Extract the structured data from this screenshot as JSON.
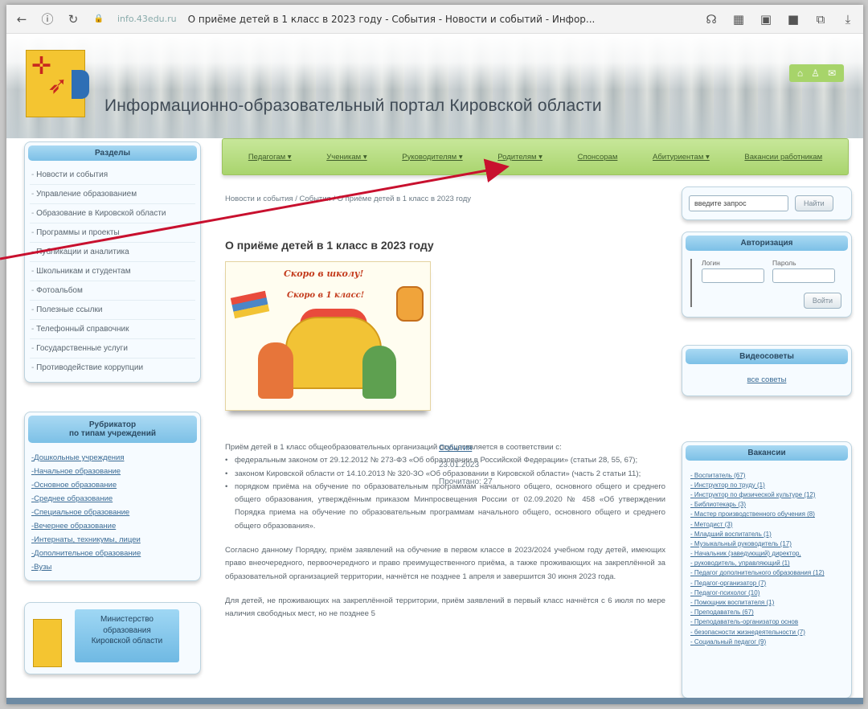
{
  "browser": {
    "back_icon": "←",
    "info_icon": "ⓘ",
    "reload_icon": "↻",
    "lock_icon": "🔒",
    "url": "info.43edu.ru",
    "tab_title": "О приёме детей в 1 класс в 2023 году - События - Новости и событий - Инфор..."
  },
  "header": {
    "site_title": "Информационно-образовательный портал Кировской области",
    "top_icons": [
      "⌂",
      "♙",
      "✉"
    ]
  },
  "sections": {
    "heading": "Разделы",
    "items": [
      "Новости и события",
      "Управление образованием",
      "Образование в Кировской области",
      "Программы и проекты",
      "Публикации и аналитика",
      "Школьникам и студентам",
      "Фотоальбом",
      "Полезные ссылки",
      "Телефонный справочник",
      "Государственные услуги",
      "Противодействие коррупции"
    ]
  },
  "rubricator": {
    "heading_line1": "Рубрикатор",
    "heading_line2": "по типам учреждений",
    "items": [
      "Дошкольные учреждения",
      "Начальное образование",
      "Основное образование",
      "Среднее образование",
      "Специальное образование",
      "Вечернее образование",
      "Интернаты, техникумы, лицеи",
      "Дополнительное образование",
      "Вузы"
    ]
  },
  "ministry": {
    "line1": "Министерство",
    "line2": "образования",
    "line3": "Кировской области"
  },
  "topnav": {
    "items": [
      "Педагогам ▾",
      "Ученикам ▾",
      "Руководителям ▾",
      "Родителям ▾",
      "Спонсорам",
      "Абитуриентам ▾",
      "Вакансии работникам"
    ]
  },
  "center": {
    "breadcrumb": "Новости и события / События / О приёме детей в 1 класс в 2023 году",
    "title": "О приёме детей в 1 класс в 2023 году",
    "hero_line1": "Скоро в школу!",
    "hero_line2": "Скоро в 1 класс!",
    "category": "События",
    "date": "23.01.2023",
    "views": "Прочитано: 27",
    "intro": "Приём детей в 1 класс общеобразовательных организаций осуществляется в соответствии с:",
    "bullets": [
      "федеральным законом от 29.12.2012 № 273-ФЗ «Об образовании в Российской Федерации» (статьи 28, 55, 67);",
      "законом Кировской области от 14.10.2013 № 320-ЗО «Об образовании в Кировской области» (часть 2 статьи 11);",
      "порядком приёма на обучение по образовательным программам начального общего, основного общего и среднего общего образования, утверждённым приказом Минпросвещения России от 02.09.2020 № 458 «Об утверждении Порядка приема на обучение по образовательным программам начального общего, основного общего и среднего общего образования»."
    ],
    "para2": "Согласно данному Порядку, приём заявлений на обучение в первом классе в 2023/2024 учебном году детей, имеющих право внеочередного, первоочередного и право преимущественного приёма, а также проживающих на закреплённой за образовательной организацией территории, начнётся не позднее 1 апреля и завершится 30 июня 2023 года.",
    "para3": "Для детей, не проживающих на закреплённой территории, приём заявлений в первый класс начнётся с 6 июля по мере наличия свободных мест, но не позднее 5"
  },
  "right": {
    "search_placeholder": "введите запрос",
    "search_button": "Найти",
    "auth_heading": "Авторизация",
    "login_label": "Логин",
    "password_label": "Пароль",
    "login_button": "Войти",
    "video_heading": "Видеосоветы",
    "video_link": "все советы",
    "vacancies_heading": "Вакансии",
    "vacancies": [
      "Воспитатель (67)",
      "Инструктор по труду (1)",
      "Инструктор по физической культуре (12)",
      "Библиотекарь (3)",
      "Мастер производственного обучения (8)",
      "Методист (3)",
      "Младший воспитатель (1)",
      "Музыкальный руководитель (17)",
      "Начальник (заведующий) директор,",
      "  руководитель, управляющий (1)",
      "Педагог дополнительного образования (12)",
      "Педагог-организатор (7)",
      "Педагог-психолог (10)",
      "Помощник воспитателя (1)",
      "Преподаватель (67)",
      "Преподаватель-организатор основ",
      "  безопасности жизнедеятельности (7)",
      "Социальный педагог (9)"
    ]
  },
  "colors": {
    "nav_green": "#a9d46d",
    "panel_blue": "#7cc0e6",
    "link_blue": "#3a6b95",
    "arrow_red": "#c8102e"
  }
}
